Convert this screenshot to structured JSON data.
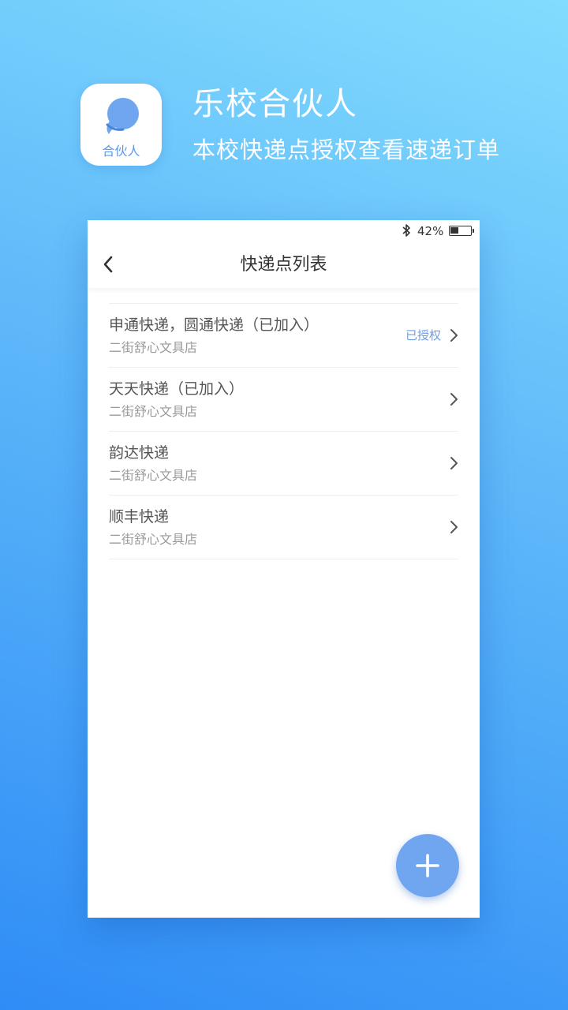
{
  "promo": {
    "app_icon_label": "合伙人",
    "title": "乐校合伙人",
    "subtitle": "本校快递点授权查看速递订单"
  },
  "status_bar": {
    "battery_percent": "42%",
    "battery_level": 0.42
  },
  "nav": {
    "title": "快递点列表"
  },
  "list": [
    {
      "title": "申通快递，圆通快递（已加入）",
      "subtitle": "二街舒心文具店",
      "badge": "已授权"
    },
    {
      "title": "天天快递（已加入）",
      "subtitle": "二街舒心文具店",
      "badge": ""
    },
    {
      "title": "韵达快递",
      "subtitle": "二街舒心文具店",
      "badge": ""
    },
    {
      "title": "顺丰快递",
      "subtitle": "二街舒心文具店",
      "badge": ""
    }
  ],
  "icons": {
    "back": "chevron-left-icon",
    "row_arrow": "chevron-right-icon",
    "fab": "plus-icon",
    "status": "bluetooth-icon"
  },
  "colors": {
    "accent": "#6fa6ef",
    "badge": "#6e9ee0",
    "background_top": "#82dcfe",
    "background_bottom": "#2f8cf6"
  }
}
